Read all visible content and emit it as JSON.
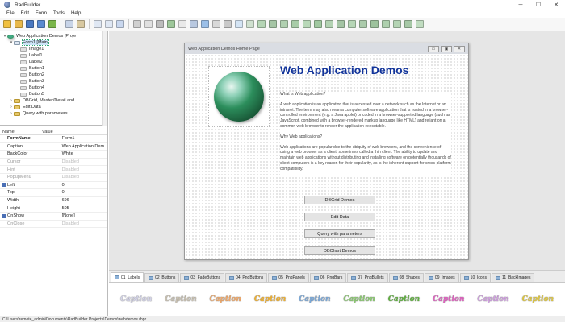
{
  "app": {
    "title": "RadBuilder"
  },
  "window_buttons": [
    "─",
    "☐",
    "✕"
  ],
  "menu": [
    "File",
    "Edit",
    "Form",
    "Tools",
    "Help"
  ],
  "toolbar_icons": [
    {
      "name": "new-project-icon",
      "color": "#f0c040"
    },
    {
      "name": "open-icon",
      "color": "#e8b84a"
    },
    {
      "name": "save-icon",
      "color": "#4a78c0"
    },
    {
      "name": "save-all-icon",
      "color": "#5a8ad0"
    },
    {
      "name": "build-icon",
      "color": "#7ab54a"
    },
    {
      "name": "sep"
    },
    {
      "name": "copy-icon",
      "color": "#c8d4e8"
    },
    {
      "name": "paste-icon",
      "color": "#d8c8a0"
    },
    {
      "name": "sep"
    },
    {
      "name": "page-icon",
      "color": "#dfe7f3"
    },
    {
      "name": "page-alt-icon",
      "color": "#dfe7f3"
    },
    {
      "name": "resize-icon",
      "color": "#c9d7ee"
    },
    {
      "name": "sep"
    },
    {
      "name": "label-icon",
      "color": "#d0d0d0"
    },
    {
      "name": "edit-icon",
      "color": "#e0e0e0"
    },
    {
      "name": "text-icon",
      "color": "#bcbcbc"
    },
    {
      "name": "button-icon",
      "color": "#9ec79a"
    },
    {
      "name": "panel-icon",
      "color": "#e9e9e9"
    },
    {
      "name": "grid-icon",
      "color": "#b8c8e0"
    },
    {
      "name": "checkbox-icon",
      "color": "#9bbfe8"
    },
    {
      "name": "listbox-icon",
      "color": "#d9d9d9"
    },
    {
      "name": "combobox-icon",
      "color": "#c9c9c9"
    },
    {
      "name": "image-icon",
      "color": "#d4e4f4"
    },
    {
      "name": "memo-icon",
      "color": "#cfe0cf"
    },
    {
      "name": "radio-icon",
      "color": "#b5d5b5"
    },
    {
      "name": "groupbox-icon",
      "color": "#a5c5a5"
    },
    {
      "name": "shape-icon",
      "color": "#b0d0b0"
    },
    {
      "name": "progress-icon",
      "color": "#a8cca8"
    },
    {
      "name": "trackbar-icon",
      "color": "#b8d8b8"
    },
    {
      "name": "timer-icon",
      "color": "#a0c8a0"
    },
    {
      "name": "media-icon",
      "color": "#b2d2b2"
    },
    {
      "name": "browser-icon",
      "color": "#a4c4a4"
    },
    {
      "name": "dbgrid-icon",
      "color": "#b6d6b6"
    },
    {
      "name": "chart-icon",
      "color": "#aacaaa"
    },
    {
      "name": "menu-icon",
      "color": "#9cc29c"
    },
    {
      "name": "dialog-icon",
      "color": "#aed0ae"
    },
    {
      "name": "tab-icon",
      "color": "#b4d4b4"
    },
    {
      "name": "flash-icon",
      "color": "#a6c8a6"
    },
    {
      "name": "preview-icon",
      "color": "#c0dcc0"
    }
  ],
  "tree": [
    {
      "level": 0,
      "twisty": "▾",
      "icon": "globe",
      "label": "Web Application Demos [Proje",
      "selected": false
    },
    {
      "level": 1,
      "twisty": "▾",
      "icon": "form",
      "label": "Form1 [Main]",
      "selected": true
    },
    {
      "level": 2,
      "twisty": "",
      "icon": "comp",
      "label": "Image1",
      "selected": false
    },
    {
      "level": 2,
      "twisty": "",
      "icon": "comp",
      "label": "Label1",
      "selected": false
    },
    {
      "level": 2,
      "twisty": "",
      "icon": "comp",
      "label": "Label2",
      "selected": false
    },
    {
      "level": 2,
      "twisty": "",
      "icon": "comp",
      "label": "Button1",
      "selected": false
    },
    {
      "level": 2,
      "twisty": "",
      "icon": "comp",
      "label": "Button2",
      "selected": false
    },
    {
      "level": 2,
      "twisty": "",
      "icon": "comp",
      "label": "Button3",
      "selected": false
    },
    {
      "level": 2,
      "twisty": "",
      "icon": "comp",
      "label": "Button4",
      "selected": false
    },
    {
      "level": 2,
      "twisty": "",
      "icon": "comp",
      "label": "Button5",
      "selected": false
    },
    {
      "level": 1,
      "twisty": "›",
      "icon": "folder",
      "label": "DBGrid, Master/Detail and",
      "selected": false
    },
    {
      "level": 1,
      "twisty": "›",
      "icon": "folder",
      "label": "Edit Data",
      "selected": false
    },
    {
      "level": 1,
      "twisty": "›",
      "icon": "folder",
      "label": "Query with parameters",
      "selected": false
    }
  ],
  "props": {
    "headers": [
      "Name",
      "Value"
    ],
    "rows": [
      {
        "name": "FormName",
        "value": "Form1",
        "bold": true,
        "dim": false,
        "mark": false
      },
      {
        "name": "Caption",
        "value": "Web Application Dem",
        "bold": false,
        "dim": false,
        "mark": false
      },
      {
        "name": "BackColor",
        "value": "White",
        "bold": false,
        "dim": false,
        "mark": false
      },
      {
        "name": "Cursor",
        "value": "Disabled",
        "bold": false,
        "dim": true,
        "mark": false
      },
      {
        "name": "Hint",
        "value": "Disabled",
        "bold": false,
        "dim": true,
        "mark": false
      },
      {
        "name": "PopupMenu",
        "value": "Disabled",
        "bold": false,
        "dim": true,
        "mark": false
      },
      {
        "name": "Left",
        "value": "0",
        "bold": false,
        "dim": false,
        "mark": true
      },
      {
        "name": "Top",
        "value": "0",
        "bold": false,
        "dim": false,
        "mark": false
      },
      {
        "name": "Width",
        "value": "696",
        "bold": false,
        "dim": false,
        "mark": false
      },
      {
        "name": "Height",
        "value": "505",
        "bold": false,
        "dim": false,
        "mark": false
      },
      {
        "name": "OnShow",
        "value": "[None]",
        "bold": false,
        "dim": false,
        "mark": true
      },
      {
        "name": "OnClose",
        "value": "Disabled",
        "bold": false,
        "dim": true,
        "mark": false
      }
    ]
  },
  "form": {
    "title": "Web Application Demos Home Page",
    "buttons": [
      "▭",
      "▣",
      "✕"
    ],
    "heading": "Web Application Demos",
    "paragraphs": [
      "What is Web application?",
      "A web application is an application that is accessed over a network such as the Internet or an intranet. The term may also mean a computer software application that is hosted in a browser-controlled environment (e.g. a Java applet) or coded in a browser-supported language (such as JavaScript, combined with a browser-rendered markup language like HTML) and reliant on a common web browser to render the application executable.",
      "Why Web applications?",
      "Web applications are popular due to the ubiquity of web browsers, and the convenience of using a web browser as a client, sometimes called a thin client. The ability to update and maintain web applications without distributing and installing software on potentially thousands of client computers is a key reason for their popularity, as is the inherent support for cross-platform compatibility."
    ],
    "action_buttons": [
      "DBGrid Demos",
      "Edit Data",
      "Query with parameters",
      "DBChart Demos"
    ]
  },
  "tabs": [
    "01_Labels",
    "02_Buttons",
    "03_FadeButtons",
    "04_PngButtons",
    "05_PngPanels",
    "06_PngBars",
    "07_PngBullets",
    "08_Shapes",
    "09_Images",
    "10_Icons",
    "11_BackImages"
  ],
  "caption_samples": [
    {
      "text": "Caption",
      "color": "#d4d4e8"
    },
    {
      "text": "Caption",
      "color": "#c8c0b0"
    },
    {
      "text": "Caption",
      "color": "#f0a868"
    },
    {
      "text": "Caption",
      "color": "#f0b030"
    },
    {
      "text": "Caption",
      "color": "#7aa8d8"
    },
    {
      "text": "Caption",
      "color": "#8ac870"
    },
    {
      "text": "Caption",
      "color": "#60b040"
    },
    {
      "text": "Caption",
      "color": "#e060c0"
    },
    {
      "text": "Caption",
      "color": "#d0a0e0"
    },
    {
      "text": "Caption",
      "color": "#e0c840"
    }
  ],
  "status": "C:\\Users\\remote_admin\\Documents\\RadBuilder Projects\\Demos\\webdemos.rbpr"
}
